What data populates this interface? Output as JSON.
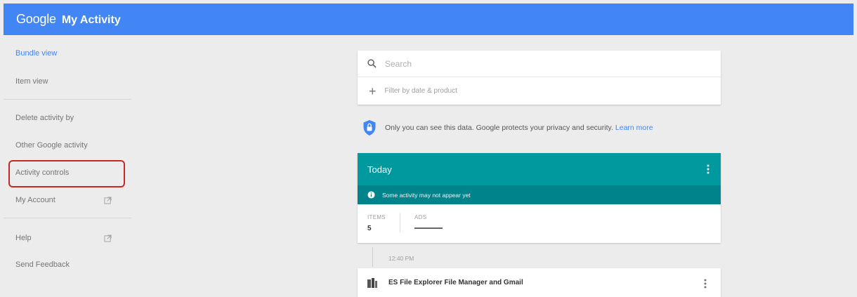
{
  "appbar": {
    "logo": "Google",
    "title": "My Activity",
    "background": "#4285f4"
  },
  "sidebar": {
    "items": [
      {
        "label": "Bundle view"
      },
      {
        "label": "Item view"
      },
      {
        "label": "Delete activity by"
      },
      {
        "label": "Other Google activity"
      },
      {
        "label": "Activity controls",
        "highlighted": true
      },
      {
        "label": "My Account",
        "icon": "external-link-icon"
      },
      {
        "label": "Help",
        "icon": "external-link-icon"
      },
      {
        "label": "Send Feedback"
      }
    ],
    "active_color": "#4285f4",
    "highlight_color": "#c62828"
  },
  "search": {
    "placeholder": "Search",
    "filter_label": "Filter by date & product"
  },
  "privacy": {
    "text": "Only you can see this data. Google protects your privacy and security.",
    "link": "Learn more"
  },
  "today": {
    "title": "Today",
    "notice": "Some activity may not appear yet",
    "header_color": "#00999e",
    "stats": [
      {
        "label": "ITEMS",
        "value": "5"
      },
      {
        "label": "ADS",
        "value": ""
      }
    ]
  },
  "timeline": {
    "time": "12:40 PM",
    "item": {
      "title": "ES File Explorer File Manager and Gmail",
      "icon": "app-icon"
    }
  }
}
